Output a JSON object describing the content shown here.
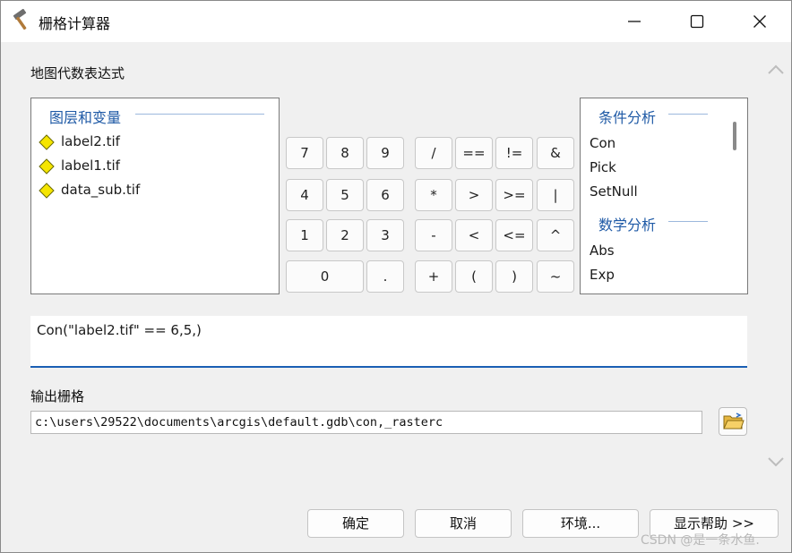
{
  "window": {
    "title": "栅格计算器"
  },
  "form": {
    "expression_section_label": "地图代数表达式",
    "layers_panel": {
      "header": "图层和变量",
      "items": [
        "label2.tif",
        "label1.tif",
        "data_sub.tif"
      ]
    },
    "keypad": {
      "row1": [
        "7",
        "8",
        "9",
        "/",
        "==",
        "!=",
        "&"
      ],
      "row2": [
        "4",
        "5",
        "6",
        "*",
        ">",
        ">=",
        "|"
      ],
      "row3": [
        "1",
        "2",
        "3",
        "-",
        "<",
        "<=",
        "^"
      ],
      "row4": [
        "0",
        ".",
        "+",
        "(",
        ")",
        "~"
      ]
    },
    "functions_panel": {
      "group1_header": "条件分析",
      "group1_items": [
        "Con",
        "Pick",
        "SetNull"
      ],
      "group2_header": "数学分析",
      "group2_items": [
        "Abs",
        "Exp"
      ]
    },
    "expression_value": "Con(\"label2.tif\" == 6,5,)",
    "output_section_label": "输出栅格",
    "output_path": "c:\\users\\29522\\documents\\arcgis\\default.gdb\\con,_rasterc"
  },
  "footer": {
    "ok_label": "确定",
    "cancel_label": "取消",
    "env_label": "环境...",
    "help_label": "显示帮助 >>"
  },
  "watermark": "CSDN @是一条水鱼.",
  "colors": {
    "accent": "#1a5fb4",
    "group_header": "#1f5aa6",
    "diamond_fill": "#f5e500"
  }
}
